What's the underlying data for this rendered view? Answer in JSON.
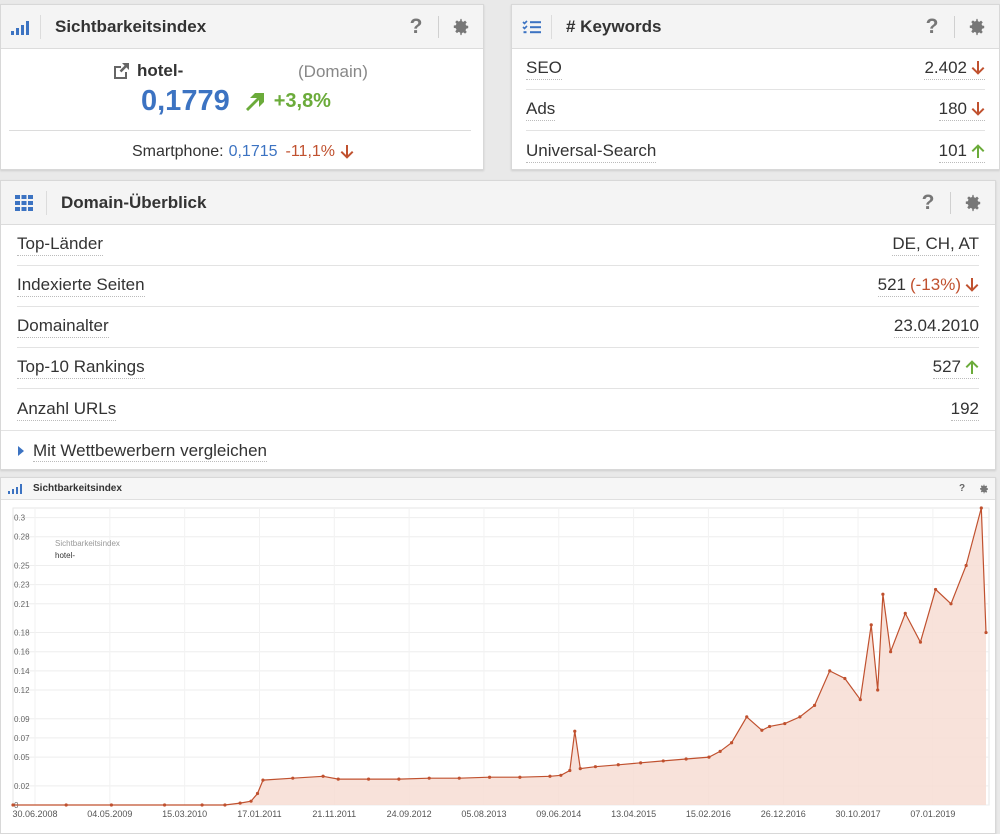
{
  "visibility": {
    "title": "Sichtbarkeitsindex",
    "domain": "hotel-",
    "domain_tag": "(Domain)",
    "value": "0,1779",
    "change": "+3,8%",
    "smartphone_label": "Smartphone:",
    "smartphone_value": "0,1715",
    "smartphone_change": "-11,1%",
    "help": "?"
  },
  "keywords": {
    "title": "# Keywords",
    "help": "?",
    "rows": [
      {
        "label": "SEO",
        "value": "2.402",
        "trend": "down"
      },
      {
        "label": "Ads",
        "value": "180",
        "trend": "down"
      },
      {
        "label": "Universal-Search",
        "value": "101",
        "trend": "up"
      }
    ]
  },
  "overview": {
    "title": "Domain-Überblick",
    "help": "?",
    "rows": [
      {
        "label": "Top-Länder",
        "value": "DE, CH, AT"
      },
      {
        "label": "Indexierte Seiten",
        "value": "521",
        "extra": "(-13%)",
        "trend": "down"
      },
      {
        "label": "Domainalter",
        "value": "23.04.2010"
      },
      {
        "label": "Top-10 Rankings",
        "value": "527",
        "trend": "up"
      },
      {
        "label": "Anzahl URLs",
        "value": "192"
      }
    ],
    "compare_label": "Mit Wettbewerbern vergleichen"
  },
  "chart_panel": {
    "title": "Sichtbarkeitsindex",
    "help": "?"
  },
  "colors": {
    "accent_blue": "#3c73c2",
    "down_red": "#c0512f",
    "up_green": "#6bab3a",
    "series": "#c0512f",
    "series_fill": "#f7ddd4"
  },
  "chart_data": {
    "type": "area",
    "title": "Sichtbarkeitsindex",
    "legend": [
      "hotel-"
    ],
    "legend_placement": "top-left",
    "grid": true,
    "ylim": [
      0,
      0.31
    ],
    "y_ticks": [
      0,
      0.02,
      0.05,
      0.07,
      0.09,
      0.12,
      0.14,
      0.16,
      0.18,
      0.21,
      0.23,
      0.25,
      0.28,
      0.3
    ],
    "x_ticks": [
      "30.06.2008",
      "04.05.2009",
      "15.03.2010",
      "17.01.2011",
      "21.11.2011",
      "24.09.2012",
      "05.08.2013",
      "09.06.2014",
      "13.04.2015",
      "15.02.2016",
      "26.12.2016",
      "30.10.2017",
      "07.01.2019"
    ],
    "series": [
      {
        "name": "hotel-",
        "x": [
          "2008-05-01",
          "2008-12-01",
          "2009-06-01",
          "2010-01-01",
          "2010-06-01",
          "2010-09-01",
          "2010-11-01",
          "2010-12-15",
          "2011-01-10",
          "2011-02-01",
          "2011-06-01",
          "2011-10-01",
          "2011-12-01",
          "2012-04-01",
          "2012-08-01",
          "2012-12-01",
          "2013-04-01",
          "2013-08-01",
          "2013-12-01",
          "2014-04-01",
          "2014-05-15",
          "2014-06-20",
          "2014-07-10",
          "2014-08-01",
          "2014-10-01",
          "2015-01-01",
          "2015-04-01",
          "2015-07-01",
          "2015-10-01",
          "2016-01-01",
          "2016-02-15",
          "2016-04-01",
          "2016-06-01",
          "2016-08-01",
          "2016-09-01",
          "2016-11-01",
          "2017-01-01",
          "2017-03-01",
          "2017-05-01",
          "2017-07-01",
          "2017-09-01",
          "2017-10-15",
          "2017-11-10",
          "2017-12-01",
          "2018-01-01",
          "2018-03-01",
          "2018-05-01",
          "2018-07-01",
          "2018-09-01",
          "2018-11-01",
          "2019-01-01",
          "2019-01-20"
        ],
        "values": [
          0.0,
          0.0,
          0.0,
          0.0,
          0.0,
          0.0,
          0.002,
          0.004,
          0.012,
          0.026,
          0.028,
          0.03,
          0.027,
          0.027,
          0.027,
          0.028,
          0.028,
          0.029,
          0.029,
          0.03,
          0.031,
          0.036,
          0.077,
          0.038,
          0.04,
          0.042,
          0.044,
          0.046,
          0.048,
          0.05,
          0.056,
          0.065,
          0.092,
          0.078,
          0.082,
          0.085,
          0.092,
          0.104,
          0.14,
          0.132,
          0.11,
          0.188,
          0.12,
          0.22,
          0.16,
          0.2,
          0.17,
          0.225,
          0.21,
          0.25,
          0.31,
          0.18
        ]
      }
    ]
  }
}
